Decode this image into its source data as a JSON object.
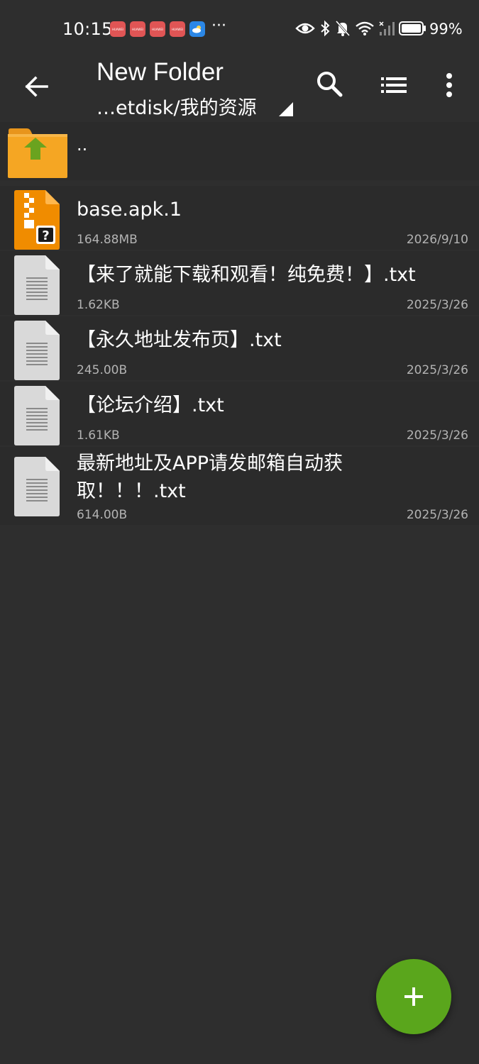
{
  "status_bar": {
    "time": "10:15",
    "more": "···",
    "battery_percent": "99%",
    "notification_apps": [
      "HUAWEI",
      "HUAWEI",
      "HUAWEI",
      "HUAWEI"
    ]
  },
  "toolbar": {
    "title": "New Folder",
    "path": "…etdisk/我的资源"
  },
  "parent_folder": {
    "label": ".."
  },
  "files": [
    {
      "name": "base.apk.1",
      "size": "164.88MB",
      "date": "2026/9/10",
      "icon": "apk-archive-icon"
    },
    {
      "name": "【来了就能下载和观看！纯免费！】.txt",
      "size": "1.62KB",
      "date": "2025/3/26",
      "icon": "text-file-icon"
    },
    {
      "name": "【永久地址发布页】.txt",
      "size": "245.00B",
      "date": "2025/3/26",
      "icon": "text-file-icon"
    },
    {
      "name": "【论坛介绍】.txt",
      "size": "1.61KB",
      "date": "2025/3/26",
      "icon": "text-file-icon"
    },
    {
      "name": "最新地址及APP请发邮箱自动获取！！！.txt",
      "size": "614.00B",
      "date": "2025/3/26",
      "icon": "text-file-icon"
    }
  ],
  "colors": {
    "background": "#2e2e2e",
    "row_background": "#2b2b2b",
    "fab": "#5aa61c",
    "folder": "#f5a623",
    "folder_arrow": "#6aa31f"
  }
}
